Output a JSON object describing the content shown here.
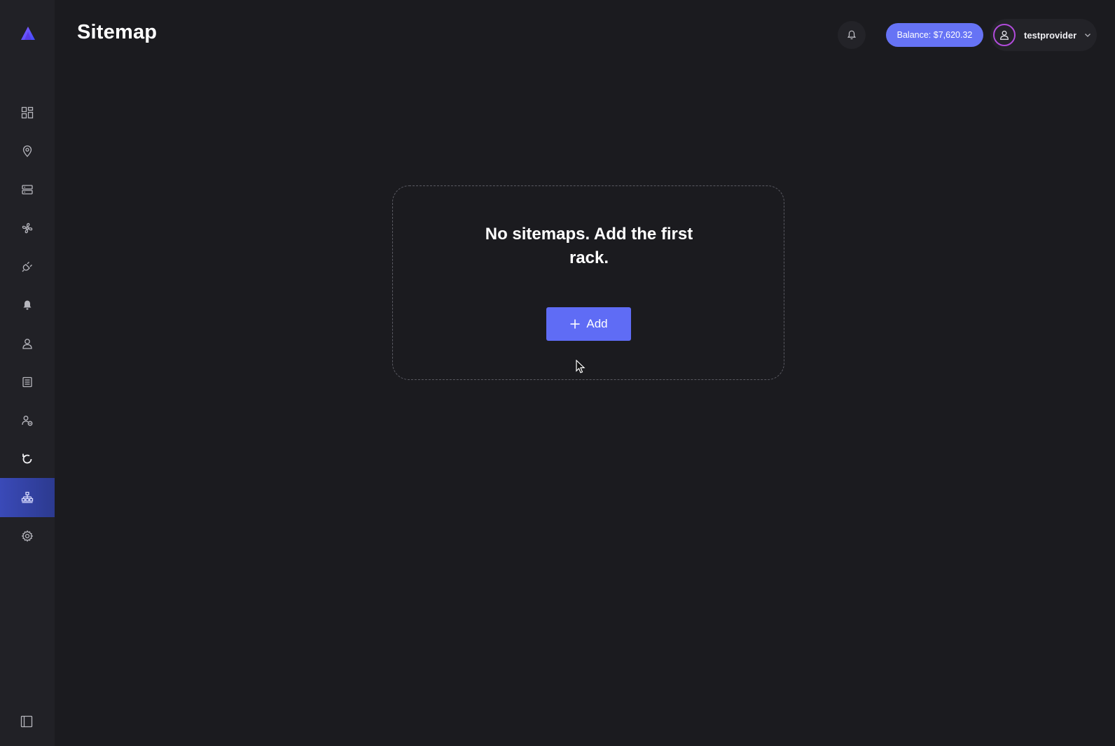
{
  "header": {
    "title": "Sitemap",
    "balance_label": "Balance: $7,620.32",
    "username": "testprovider"
  },
  "sidebar": {
    "items": [
      {
        "icon": "dashboard-icon"
      },
      {
        "icon": "location-pin-icon"
      },
      {
        "icon": "server-icon"
      },
      {
        "icon": "fan-icon"
      },
      {
        "icon": "plug-icon"
      },
      {
        "icon": "bell-icon"
      },
      {
        "icon": "user-icon"
      },
      {
        "icon": "document-list-icon"
      },
      {
        "icon": "user-group-icon"
      },
      {
        "icon": "refresh-icon"
      },
      {
        "icon": "sitemap-icon",
        "active": true
      },
      {
        "icon": "gear-icon"
      }
    ]
  },
  "empty_state": {
    "message": "No sitemaps. Add the first rack.",
    "add_label": "Add"
  },
  "colors": {
    "accent": "#5f6cf5",
    "balance_bg": "#6673f5",
    "active_nav": "#3a4ab8",
    "avatar_ring": "#b14bdb",
    "background": "#1b1b1f",
    "sidebar": "#212126"
  }
}
